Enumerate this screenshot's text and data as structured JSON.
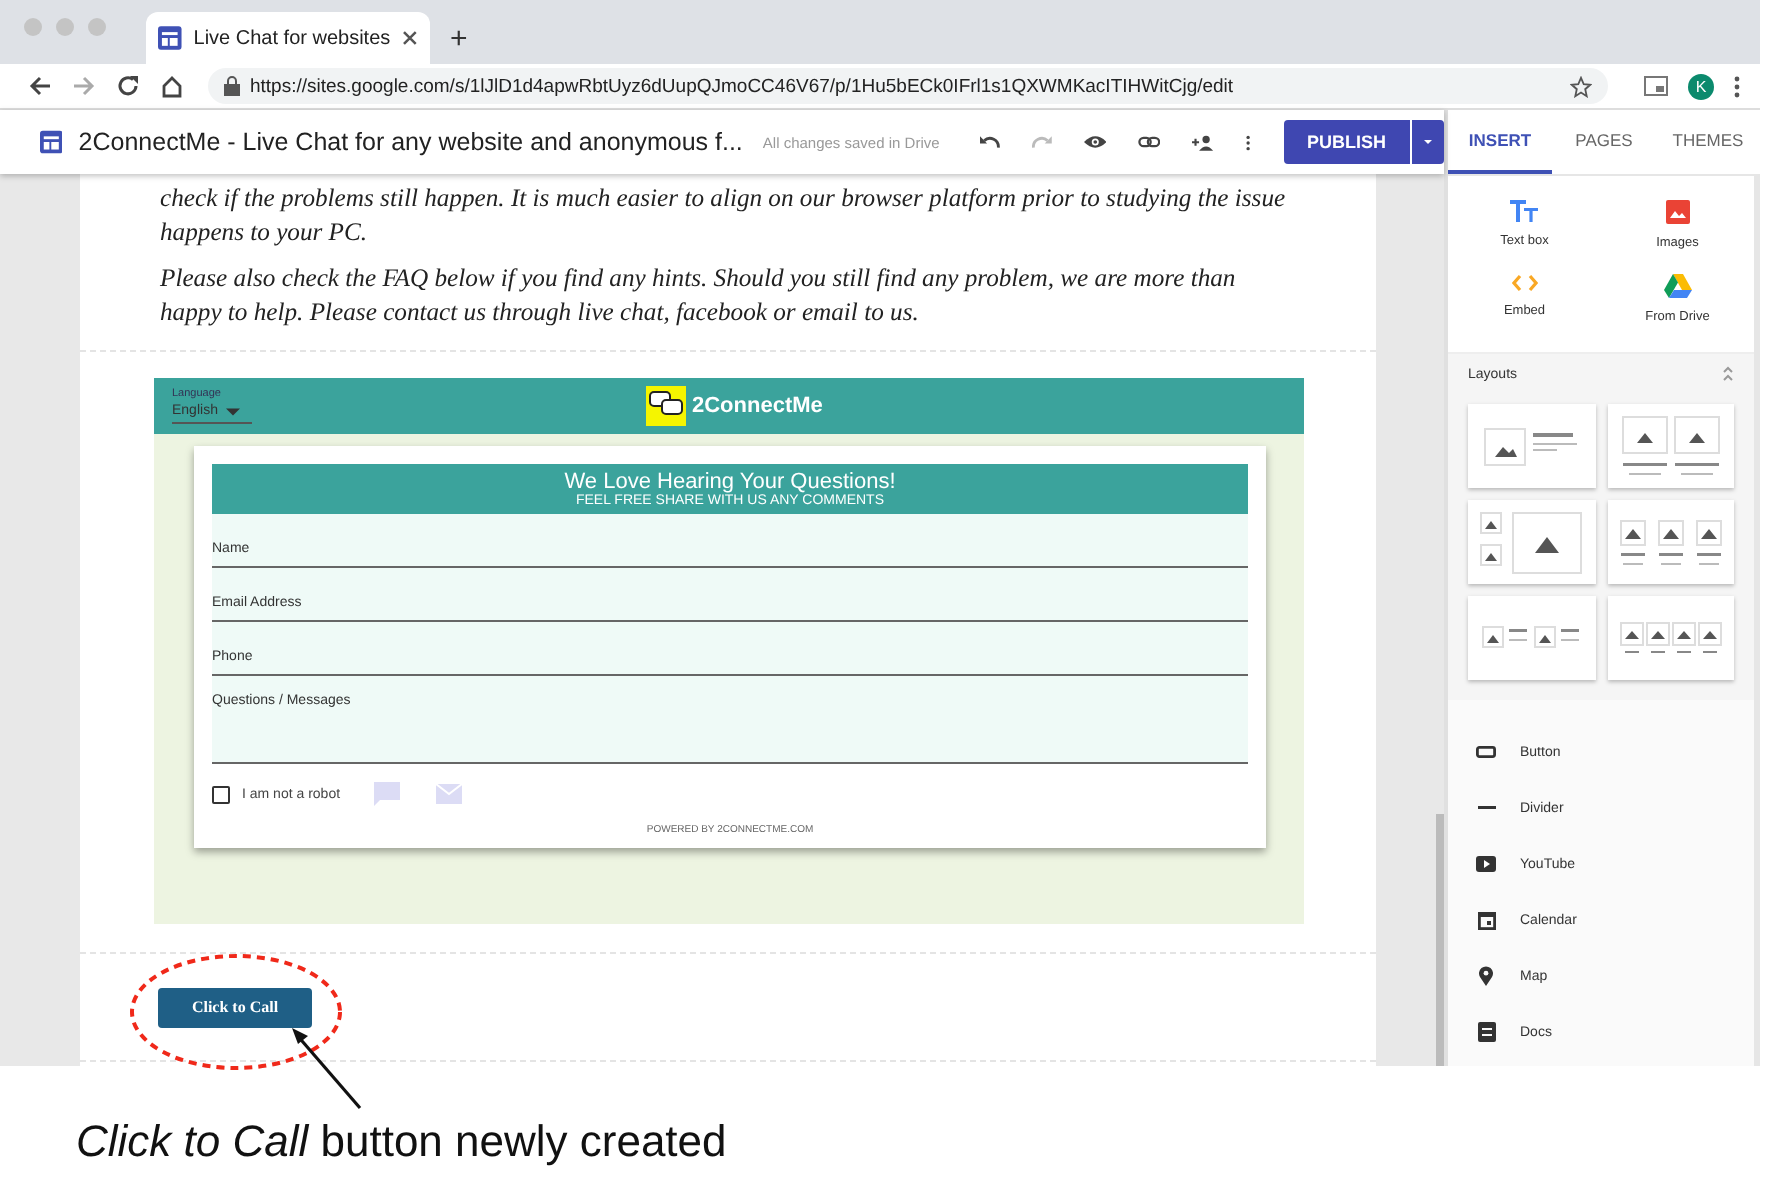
{
  "browser": {
    "tab_title": "Live Chat for websites",
    "new_tab": "+",
    "url": "https://sites.google.com/s/1lJlD1d4apwRbtUyz6dUupQJmoCC46V67/p/1Hu5bECk0IFrl1s1QXWMKacITIHWitCjg/edit",
    "avatar": "K"
  },
  "toolbar": {
    "site_title": "2ConnectMe - Live Chat for any website and anonymous f...",
    "save_status": "All changes saved in Drive",
    "publish": "PUBLISH"
  },
  "content": {
    "paragraphs": [
      "check if the problems still happen. It is much easier to align on our browser platform prior to studying the issue happens to your PC.",
      "Please also check the FAQ below if you find any hints. Should you still find any problem, we are more than happy to help. Please contact us through live chat, facebook or email to us."
    ],
    "widget": {
      "language_label": "Language",
      "language": "English",
      "brand": "2ConnectMe",
      "heading": "We Love Hearing Your Questions!",
      "subheading": "FEEL FREE SHARE WITH US ANY COMMENTS",
      "fields": [
        {
          "placeholder": "Name",
          "kind": "line"
        },
        {
          "placeholder": "Email Address",
          "kind": "line"
        },
        {
          "placeholder": "Phone",
          "kind": "line"
        },
        {
          "placeholder": "Questions / Messages",
          "kind": "area"
        }
      ],
      "robot": {
        "label": "I am not a robot",
        "checked": false
      },
      "powered_by": "POWERED BY 2CONNECTME.COM"
    },
    "button": "Click to Call"
  },
  "panel": {
    "tabs": [
      {
        "label": "INSERT",
        "selected": true
      },
      {
        "label": "PAGES",
        "selected": false
      },
      {
        "label": "THEMES",
        "selected": false
      }
    ],
    "insert_items": [
      {
        "label": "Text box",
        "kind": "text"
      },
      {
        "label": "Images",
        "kind": "image"
      },
      {
        "label": "Embed",
        "kind": "embed"
      },
      {
        "label": "From Drive",
        "kind": "drive"
      }
    ],
    "layouts_title": "Layouts",
    "components": [
      {
        "label": "Button",
        "kind": "button"
      },
      {
        "label": "Divider",
        "kind": "divider"
      },
      {
        "label": "YouTube",
        "kind": "youtube"
      },
      {
        "label": "Calendar",
        "kind": "calendar"
      },
      {
        "label": "Map",
        "kind": "map"
      },
      {
        "label": "Docs",
        "kind": "docs"
      }
    ]
  },
  "annotation": {
    "caption": "*Click to Call* button newly created"
  }
}
